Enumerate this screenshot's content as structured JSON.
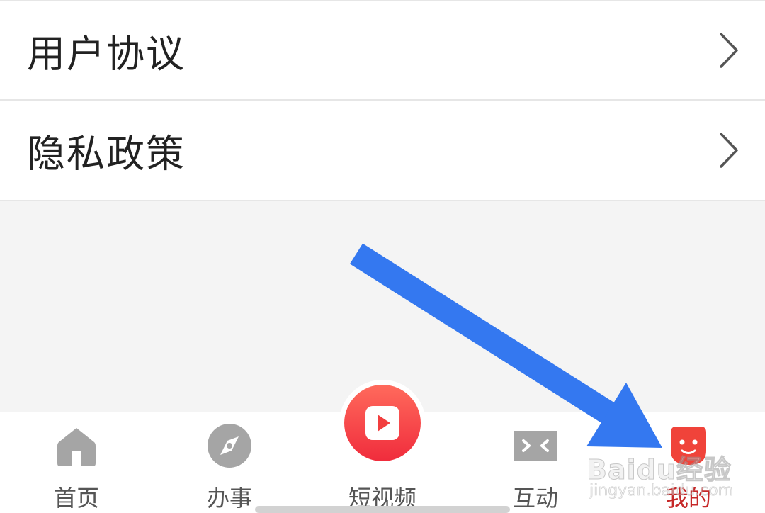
{
  "settings_list": {
    "items": [
      {
        "label": "用户协议",
        "icon": "chevron-right-icon"
      },
      {
        "label": "隐私政策",
        "icon": "chevron-right-icon"
      }
    ]
  },
  "tab_bar": {
    "tabs": [
      {
        "label": "首页",
        "icon": "home-icon",
        "active": false
      },
      {
        "label": "办事",
        "icon": "compass-icon",
        "active": false
      },
      {
        "label": "短视频",
        "icon": "video-play-icon",
        "active": false
      },
      {
        "label": "互动",
        "icon": "interact-icon",
        "active": false
      },
      {
        "label": "我的",
        "icon": "profile-face-icon",
        "active": true
      }
    ]
  },
  "annotation": {
    "arrow_color": "#3478f0"
  },
  "watermark": {
    "brand": "Baidu经验",
    "domain": "jingyan.baidu.com"
  },
  "colors": {
    "active_tab": "#c62828",
    "inactive_tab": "#555555",
    "video_button": "#f23e3e",
    "page_background": "#f4f4f4"
  }
}
